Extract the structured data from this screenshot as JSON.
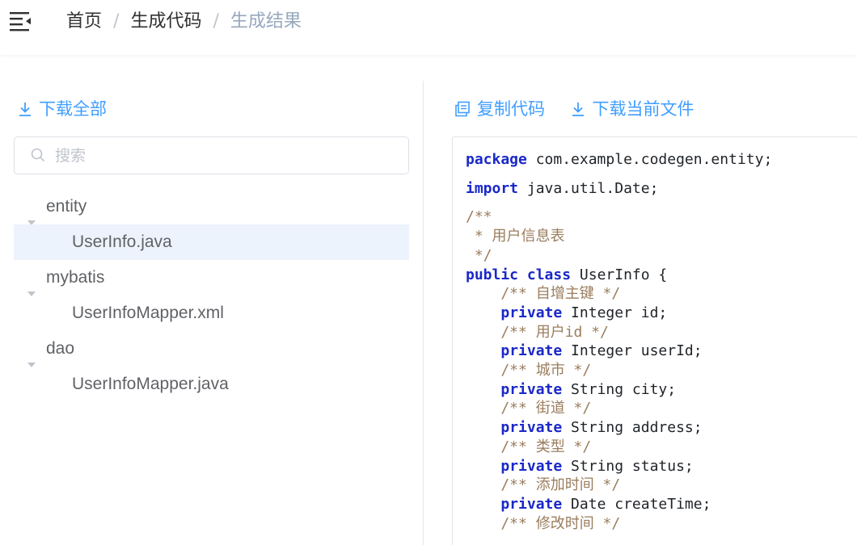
{
  "breadcrumb": {
    "items": [
      "首页",
      "生成代码",
      "生成结果"
    ],
    "separator": "/"
  },
  "left_panel": {
    "download_all_label": "下载全部",
    "search_placeholder": "搜索",
    "tree": [
      {
        "type": "folder",
        "label": "entity",
        "expanded": true
      },
      {
        "type": "file",
        "label": "UserInfo.java",
        "selected": true
      },
      {
        "type": "folder",
        "label": "mybatis",
        "expanded": true
      },
      {
        "type": "file",
        "label": "UserInfoMapper.xml",
        "selected": false
      },
      {
        "type": "folder",
        "label": "dao",
        "expanded": true
      },
      {
        "type": "file",
        "label": "UserInfoMapper.java",
        "selected": false
      }
    ]
  },
  "right_panel": {
    "copy_label": "复制代码",
    "download_current_label": "下载当前文件",
    "code": {
      "package_kw": "package",
      "package_rest": " com.example.codegen.entity;",
      "import_kw": "import",
      "import_rest": " java.util.Date;",
      "doc_open": "/**",
      "doc_line": " * 用户信息表",
      "doc_close": " */",
      "class_kw1": "public",
      "class_kw2": "class",
      "class_rest": " UserInfo {",
      "fields": [
        {
          "comment": "    /** 自增主键 */",
          "kw": "private",
          "decl": " Integer id;"
        },
        {
          "comment": "    /** 用户id */",
          "kw": "private",
          "decl": " Integer userId;"
        },
        {
          "comment": "    /** 城市 */",
          "kw": "private",
          "decl": " String city;"
        },
        {
          "comment": "    /** 街道 */",
          "kw": "private",
          "decl": " String address;"
        },
        {
          "comment": "    /** 类型 */",
          "kw": "private",
          "decl": " String status;"
        },
        {
          "comment": "    /** 添加时间 */",
          "kw": "private",
          "decl": " Date createTime;"
        }
      ],
      "last_comment": "    /** 修改时间 */"
    }
  },
  "colors": {
    "accent": "#409eff",
    "selected_bg": "#ecf3fd",
    "keyword": "#1a28c8",
    "comment": "#9a7d5d"
  },
  "icons": {
    "menu": "hamburger-fold-icon",
    "download": "download-icon",
    "search": "search-icon",
    "copy": "copy-document-icon",
    "caret": "caret-down-icon"
  }
}
